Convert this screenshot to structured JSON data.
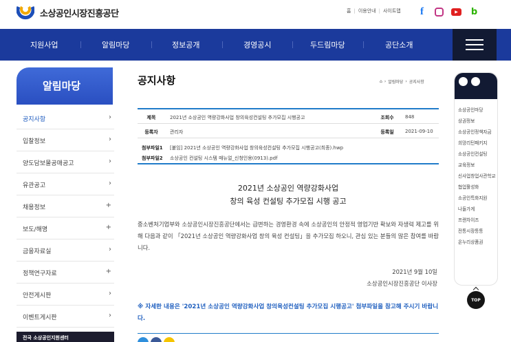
{
  "header": {
    "logo_text": "소상공인시장진흥공단",
    "util_links": [
      "홈",
      "이용안내",
      "사이트맵"
    ],
    "sns": [
      "facebook-icon",
      "instagram-icon",
      "youtube-icon",
      "blog-icon"
    ]
  },
  "gnb": {
    "items": [
      "지원사업",
      "알림마당",
      "정보공개",
      "경영공시",
      "두드림마당",
      "공단소개"
    ]
  },
  "lnb": {
    "title": "알림마당",
    "items": [
      {
        "label": "공지사항",
        "icon": "›"
      },
      {
        "label": "입찰정보",
        "icon": "›"
      },
      {
        "label": "양도담보물공매공고",
        "icon": "›"
      },
      {
        "label": "유관공고",
        "icon": "›"
      },
      {
        "label": "채용정보",
        "icon": "+"
      },
      {
        "label": "보도/해명",
        "icon": "+"
      },
      {
        "label": "금융자료실",
        "icon": "›"
      },
      {
        "label": "정책연구자료",
        "icon": "+"
      },
      {
        "label": "안전게시판",
        "icon": "›"
      },
      {
        "label": "이벤트게시판",
        "icon": "›"
      }
    ],
    "bottom_label": "전국 소상공인지원센터"
  },
  "content": {
    "page_title": "공지사항",
    "breadcrumb": [
      "알림마당",
      "공지사항"
    ],
    "labels": {
      "subject": "제목",
      "views": "조회수",
      "author": "등록자",
      "date": "등록일",
      "file1": "첨부파일1",
      "file2": "첨부파일2"
    },
    "subject": "2021년 소상공인 역량강화사업 창의육성컨설팅 추가모집 시행공고",
    "views": "848",
    "author": "관리자",
    "date": "2021-09-10",
    "file1": "[붙임] 2021년 소상공인 역량강화사업 창의육성컨설팅 추가모집 시행공고(최종).hwp",
    "file2": "소상공인 컨설팅 시스템 매뉴얼_신청인용(0913).pdf",
    "body_title_1": "2021년 소상공인 역량강화사업",
    "body_title_2": "창의 육성 컨설팅 추가모집 시행 공고",
    "body_para": "중소벤처기업부와 소상공인시장진흥공단에서는 급변하는 경영환경 속에 소상공인의 안정적 영업기반 확보와 자생력 제고를 위해 다음과 같이 「2021년 소상공인 역량강화사업 창의 육성 컨설팅」을 추가모집 하오니, 관심 있는 분들의 많은 참여를 바랍니다.",
    "sign_date": "2021년 9월 10일",
    "sign_org": "소상공인시장진흥공단 이사장",
    "notice": "※ 자세한 내용은 '2021년 소상공인 역량강화사업 창의육성컨설팅 추가모집 시행공고' 첨부파일을 참고해 주시기 바랍니다."
  },
  "quick_menu": {
    "items": [
      "소상공인마당",
      "상권정보",
      "소상공인정책자금",
      "희망리턴패키지",
      "소상공인컨설팅",
      "교육정보",
      "신사업창업사관학교",
      "협업활성화",
      "소공인특화지원",
      "나들가게",
      "프랜차이즈",
      "전통시장통통",
      "온누리상품권"
    ],
    "top_label": "TOP"
  },
  "colors": {
    "gnb": "#1b3a9c",
    "accent": "#1f7bc9",
    "active": "#1e5bbf"
  }
}
